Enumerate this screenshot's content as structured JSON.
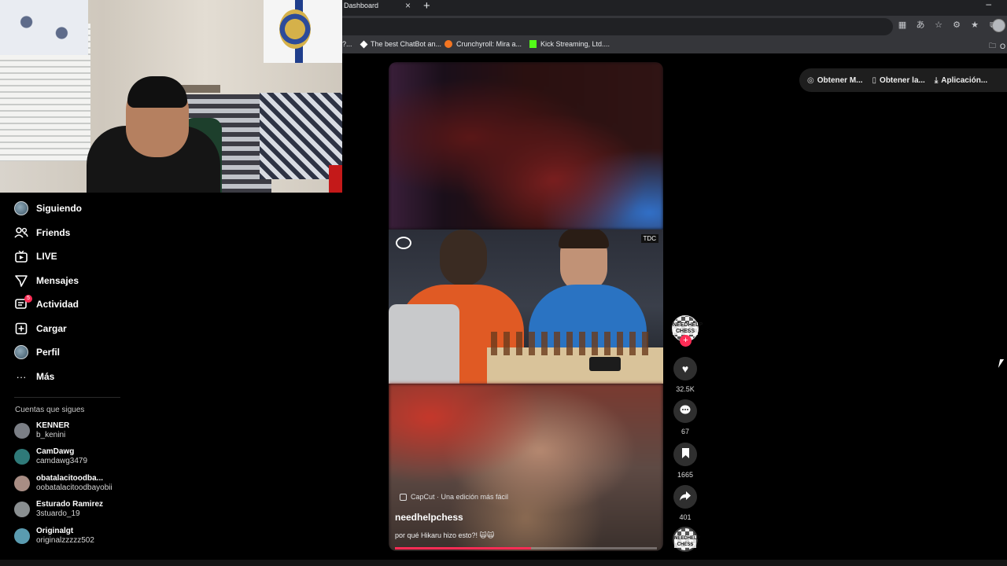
{
  "browser": {
    "tab_title": "Dashboard",
    "tab_close": "×",
    "new_tab": "+",
    "minimize": "–",
    "bookmarks": [
      {
        "label": "?..."
      },
      {
        "label": "The best ChatBot an..."
      },
      {
        "label": "Crunchyroll: Mira a..."
      },
      {
        "label": "Kick Streaming, Ltd...."
      },
      {
        "label": "O"
      }
    ]
  },
  "sidebar": {
    "items": [
      {
        "label": "Siguiendo",
        "icon": "avatar-icon"
      },
      {
        "label": "Friends",
        "icon": "friends-icon"
      },
      {
        "label": "LIVE",
        "icon": "live-icon"
      },
      {
        "label": "Mensajes",
        "icon": "messages-icon"
      },
      {
        "label": "Actividad",
        "icon": "activity-icon",
        "badge": "5"
      },
      {
        "label": "Cargar",
        "icon": "upload-icon"
      },
      {
        "label": "Perfil",
        "icon": "profile-icon"
      },
      {
        "label": "Más",
        "icon": "more-icon"
      }
    ],
    "following_title": "Cuentas que sigues",
    "accounts": [
      {
        "name": "KENNER",
        "handle": "b_kenini",
        "color": "#7b7f86"
      },
      {
        "name": "CamDawg",
        "handle": "camdawg3479",
        "color": "#2f7a79"
      },
      {
        "name": "obatalacitoodba...",
        "handle": "oobatalacitoodbayobii",
        "color": "#a88d84"
      },
      {
        "name": "Esturado Ramirez",
        "handle": "3stuardo_19",
        "color": "#8a8f91"
      },
      {
        "name": "Originalgt",
        "handle": "originalzzzzz502",
        "color": "#5a9bb0"
      }
    ]
  },
  "video": {
    "capcut_label": "CapCut · Una edición más fácil",
    "author": "needhelpchess",
    "caption": "por qué Hikaru hizo esto?! 🙀🙀",
    "progress": 0.52,
    "clip_logo": "TDC"
  },
  "rail": {
    "avatar_text": "NEEDHELP CHESS",
    "follow_symbol": "+",
    "likes": "32.5K",
    "comments": "67",
    "saves": "1665",
    "shares": "401",
    "music_text": "NEEDHELP CHESS"
  },
  "top_pills": [
    {
      "label": "Obtener M...",
      "icon": "coin-icon"
    },
    {
      "label": "Obtener la...",
      "icon": "phone-icon"
    },
    {
      "label": "Aplicación...",
      "icon": "download-icon"
    }
  ],
  "colors": {
    "accent": "#fe2c55",
    "background": "#000000"
  }
}
